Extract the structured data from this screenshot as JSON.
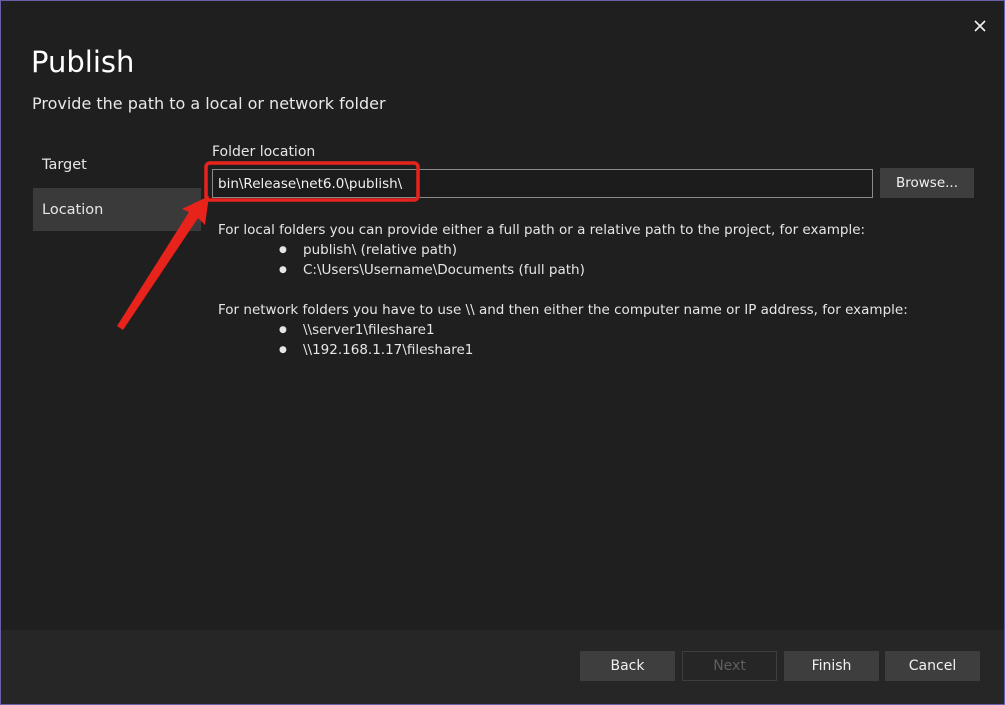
{
  "dialog": {
    "title": "Publish",
    "subtitle": "Provide the path to a local or network folder"
  },
  "nav": {
    "items": [
      {
        "label": "Target",
        "selected": false
      },
      {
        "label": "Location",
        "selected": true
      }
    ]
  },
  "folder": {
    "label": "Folder location",
    "value": "bin\\Release\\net6.0\\publish\\",
    "browse_label": "Browse..."
  },
  "help": {
    "local_intro": "For local folders you can provide either a full path or a relative path to the project, for example:",
    "local_examples": [
      "publish\\ (relative path)",
      "C:\\Users\\Username\\Documents (full path)"
    ],
    "network_intro": "For network folders you have to use \\\\ and then either the computer name or IP address, for example:",
    "network_examples": [
      "\\\\server1\\fileshare1",
      "\\\\192.168.1.17\\fileshare1"
    ]
  },
  "footer": {
    "back_label": "Back",
    "next_label": "Next",
    "finish_label": "Finish",
    "cancel_label": "Cancel"
  },
  "colors": {
    "background": "#1f1f1f",
    "button": "#3e3e3e",
    "selected_nav": "#3a3a3a",
    "annotation": "#e8231c"
  },
  "icons": {
    "close": "close-icon"
  }
}
